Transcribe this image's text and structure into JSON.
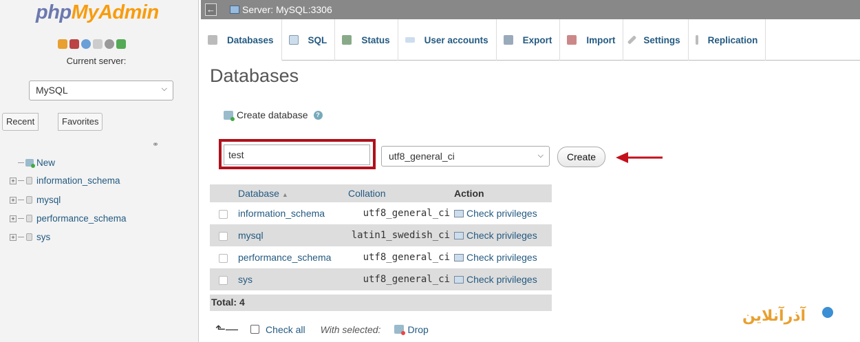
{
  "sidebar": {
    "logo_php": "php",
    "logo_admin": "MyAdmin",
    "current_server_label": "Current server:",
    "server_selected": "MySQL",
    "recent_tab": "Recent",
    "favorites_tab": "Favorites",
    "tree": [
      {
        "label": "New"
      },
      {
        "label": "information_schema"
      },
      {
        "label": "mysql"
      },
      {
        "label": "performance_schema"
      },
      {
        "label": "sys"
      }
    ]
  },
  "topbar": {
    "back": "←",
    "server_label": "Server: MySQL:3306"
  },
  "tabs": [
    {
      "label": "Databases",
      "icon": "database-icon"
    },
    {
      "label": "SQL",
      "icon": "sql-icon"
    },
    {
      "label": "Status",
      "icon": "status-icon"
    },
    {
      "label": "User accounts",
      "icon": "users-icon"
    },
    {
      "label": "Export",
      "icon": "export-icon"
    },
    {
      "label": "Import",
      "icon": "import-icon"
    },
    {
      "label": "Settings",
      "icon": "wrench-icon"
    },
    {
      "label": "Replication",
      "icon": "replication-icon"
    }
  ],
  "main": {
    "title": "Databases",
    "create_heading": "Create database",
    "db_name_value": "test",
    "collation_value": "utf8_general_ci",
    "create_button": "Create",
    "table": {
      "headers": [
        "Database",
        "Collation",
        "Action"
      ],
      "sort_indicator": "▲",
      "rows": [
        {
          "name": "information_schema",
          "collation": "utf8_general_ci",
          "action": "Check privileges"
        },
        {
          "name": "mysql",
          "collation": "latin1_swedish_ci",
          "action": "Check privileges"
        },
        {
          "name": "performance_schema",
          "collation": "utf8_general_ci",
          "action": "Check privileges"
        },
        {
          "name": "sys",
          "collation": "utf8_general_ci",
          "action": "Check privileges"
        }
      ],
      "total": "Total: 4"
    },
    "check_all": "Check all",
    "with_selected": "With selected:",
    "drop": "Drop"
  },
  "watermark": "آذرآنلاین",
  "colors": {
    "link": "#235a81",
    "highlight": "#b0101c",
    "logo_php": "#6c78af",
    "logo_admin": "#f89c0e"
  }
}
